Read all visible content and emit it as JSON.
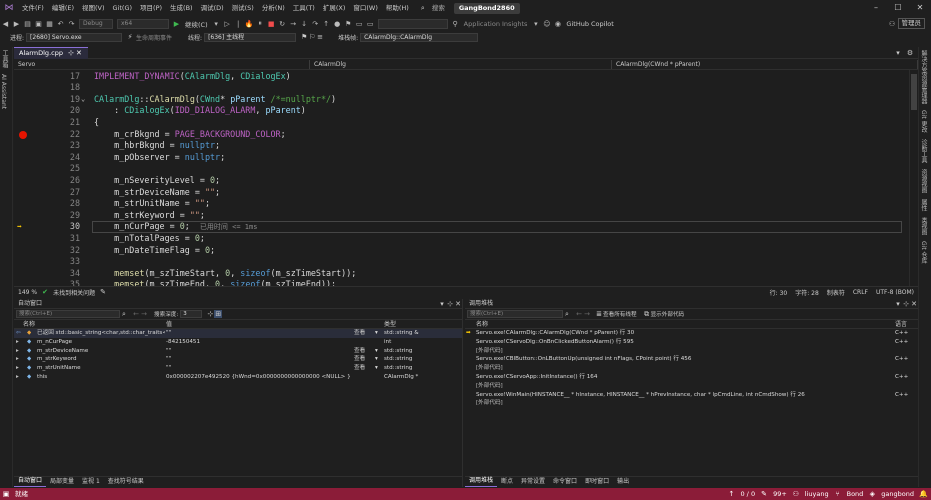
{
  "menubar": {
    "items": [
      "文件(F)",
      "编辑(E)",
      "视图(V)",
      "Git(G)",
      "项目(P)",
      "生成(B)",
      "调试(D)",
      "测试(S)",
      "分析(N)",
      "工具(T)",
      "扩展(X)",
      "窗口(W)",
      "帮助(H)"
    ],
    "search_label": "搜索",
    "solution": "GangBond2860"
  },
  "toolbar": {
    "config": "Debug",
    "platform": "x64",
    "continue": "继续(C)",
    "app_insights": "Application Insights",
    "copilot": "GitHub Copilot",
    "admin": "管理员"
  },
  "procbar": {
    "process_label": "进程:",
    "process": "[2680] Servo.exe",
    "lifecycle": "生命周期事件",
    "thread_label": "线程:",
    "thread": "[636] 主线程",
    "frame_label": "堆栈帧:",
    "frame": "CAlarmDlg::CAlarmDlg"
  },
  "sidebars": {
    "left": [
      "工具箱",
      "AI Assistant"
    ],
    "right": [
      "解决方案资源管理器",
      "Git 更改",
      "诊断工具",
      "资源视图",
      "属性",
      "类视图",
      "Git 仓库"
    ]
  },
  "editor": {
    "tab": "AlarmDlg.cpp",
    "nav": {
      "project": "Servo",
      "scope": "CAlarmDlg",
      "member": "CAlarmDlg(CWnd * pParent)"
    },
    "lines": [
      {
        "n": "17",
        "h": "<span class='mac'>IMPLEMENT_DYNAMIC</span>(<span class='t'>CAlarmDlg</span>, <span class='t'>CDialogEx</span>)"
      },
      {
        "n": "18",
        "h": ""
      },
      {
        "n": "19",
        "h": "<span class='t'>CAlarmDlg</span>::<span class='f'>CAlarmDlg</span>(<span class='t'>CWnd</span>* <span class='p'>pParent</span> <span class='cm'>/*=nullptr*/</span>)"
      },
      {
        "n": "20",
        "h": "    : <span class='t'>CDialogEx</span>(<span class='mac'>IDD_DIALOG_ALARM</span>, <span class='p'>pParent</span>)"
      },
      {
        "n": "21",
        "h": "{"
      },
      {
        "n": "22",
        "h": "    <span class='m'>m_crBkgnd</span> = <span class='mac'>PAGE_BACKGROUND_COLOR</span>;"
      },
      {
        "n": "23",
        "h": "    <span class='m'>m_hbrBkgnd</span> = <span class='k'>nullptr</span>;"
      },
      {
        "n": "24",
        "h": "    <span class='m'>m_pObserver</span> = <span class='k'>nullptr</span>;"
      },
      {
        "n": "25",
        "h": ""
      },
      {
        "n": "26",
        "h": "    <span class='m'>m_nSeverityLevel</span> = <span class='n'>0</span>;"
      },
      {
        "n": "27",
        "h": "    <span class='m'>m_strDeviceName</span> = <span class='s'>\"\"</span>;"
      },
      {
        "n": "28",
        "h": "    <span class='m'>m_strUnitName</span> = <span class='s'>\"\"</span>;"
      },
      {
        "n": "29",
        "h": "    <span class='m'>m_strKeyword</span> = <span class='s'>\"\"</span>;"
      },
      {
        "n": "30",
        "h": "    <span class='m'>m_nCurPage</span> = <span class='n'>0</span>;  <span class='hint'>已用时间 &lt;= 1ms</span>"
      },
      {
        "n": "31",
        "h": "    <span class='m'>m_nTotalPages</span> = <span class='n'>0</span>;"
      },
      {
        "n": "32",
        "h": "    <span class='m'>m_nDateTimeFlag</span> = <span class='n'>0</span>;"
      },
      {
        "n": "33",
        "h": ""
      },
      {
        "n": "34",
        "h": "    <span class='f'>memset</span>(<span class='m'>m_szTimeStart</span>, <span class='n'>0</span>, <span class='k'>sizeof</span>(<span class='m'>m_szTimeStart</span>));"
      },
      {
        "n": "35",
        "h": "    <span class='f'>memset</span>(<span class='m'>m_szTimeEnd</span>, <span class='n'>0</span>, <span class='k'>sizeof</span>(<span class='m'>m_szTimeEnd</span>));"
      }
    ],
    "status": {
      "zoom": "149 %",
      "issues": "未找到相关问题",
      "line": "行: 30",
      "char": "字符: 28",
      "mode": "制表符",
      "eol": "CRLF",
      "encoding": "UTF-8 (BOM)"
    }
  },
  "autos": {
    "title": "自动窗口",
    "search_placeholder": "搜索(Ctrl+E)",
    "depth_label": "搜索深度:",
    "depth": "3",
    "headers": {
      "name": "名称",
      "value": "值",
      "type": "类型"
    },
    "view_label": "查看",
    "rows": [
      {
        "name": "已返回 std::basic_string<char,std::char_traits<c...",
        "value": "\"\"",
        "view": true,
        "type": "std::string &"
      },
      {
        "name": "m_nCurPage",
        "value": "-842150451",
        "view": false,
        "type": "int"
      },
      {
        "name": "m_strDeviceName",
        "value": "\"\"",
        "view": true,
        "type": "std::string"
      },
      {
        "name": "m_strKeyword",
        "value": "\"\"",
        "view": true,
        "type": "std::string"
      },
      {
        "name": "m_strUnitName",
        "value": "\"\"",
        "view": true,
        "type": "std::string"
      },
      {
        "name": "this",
        "value": "0x000002207e492520 {hWnd=0x0000000000000000 <NULL> }",
        "view": false,
        "type": "CAlarmDlg *"
      }
    ],
    "tabs": [
      "自动窗口",
      "局部变量",
      "监视 1",
      "查找符号结果"
    ]
  },
  "callstack": {
    "title": "调用堆栈",
    "search_placeholder": "搜索(Ctrl+E)",
    "view_all_threads": "查看所有线程",
    "show_external": "显示外部代码",
    "headers": {
      "name": "名称",
      "lang": "语言"
    },
    "rows": [
      {
        "name": "Servo.exe!CAlarmDlg::CAlarmDlg(CWnd * pParent) 行 30",
        "lang": "C++"
      },
      {
        "name": "Servo.exe!CServoDlg::OnBnClickedButtonAlarm() 行 595",
        "lang": "C++"
      },
      {
        "name": "[外部代码]",
        "lang": ""
      },
      {
        "name": "Servo.exe!CBlButton::OnLButtonUp(unsigned int nFlags, CPoint point) 行 456",
        "lang": "C++"
      },
      {
        "name": "[外部代码]",
        "lang": ""
      },
      {
        "name": "Servo.exe!CServoApp::InitInstance() 行 164",
        "lang": "C++"
      },
      {
        "name": "[外部代码]",
        "lang": ""
      },
      {
        "name": "Servo.exe!WinMain(HINSTANCE__ * hInstance, HINSTANCE__ * hPrevInstance, char * lpCmdLine, int nCmdShow) 行 26",
        "lang": "C++"
      },
      {
        "name": "[外部代码]",
        "lang": ""
      }
    ],
    "tabs": [
      "调用堆栈",
      "断点",
      "异常设置",
      "命令窗口",
      "即时窗口",
      "输出"
    ]
  },
  "statusbar": {
    "ready": "就绪",
    "errors": "0 / 0",
    "changes": "99+",
    "user": "liuyang",
    "branch": "Bond",
    "repo": "gangbond"
  }
}
